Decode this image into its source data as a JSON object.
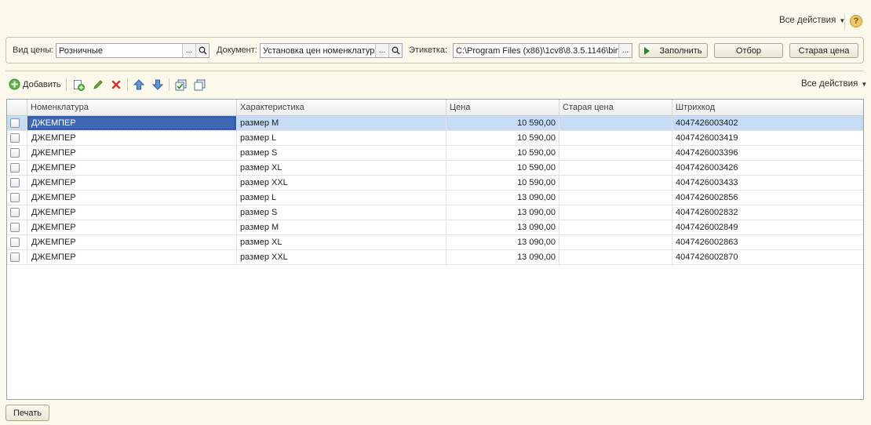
{
  "header": {
    "all_actions": "Все действия",
    "help": "?"
  },
  "filters": {
    "price_type_label": "Вид цены:",
    "price_type_value": "Розничные",
    "document_label": "Документ:",
    "document_value": "Установка цен номенклатур",
    "label_label": "Этикетка:",
    "label_value": "C:\\Program Files (x86)\\1cv8\\8.3.5.1146\\bin",
    "ellipsis": "...",
    "fill_button": "Заполнить",
    "filter_button": "Отбор",
    "old_price_button": "Старая цена"
  },
  "toolbar": {
    "add_label": "Добавить",
    "all_actions": "Все действия",
    "icons": [
      "add-icon",
      "copy-icon",
      "edit-icon",
      "delete-icon",
      "move-up-icon",
      "move-down-icon",
      "check-all-icon",
      "uncheck-all-icon"
    ]
  },
  "table": {
    "columns": [
      "Номенклатура",
      "Характеристика",
      "Цена",
      "Старая цена",
      "Штрихкод"
    ],
    "rows": [
      {
        "name": "ДЖЕМПЕР",
        "char": "размер M",
        "price": "10 590,00",
        "old": "",
        "barcode": "4047426003402"
      },
      {
        "name": "ДЖЕМПЕР",
        "char": "размер L",
        "price": "10 590,00",
        "old": "",
        "barcode": "4047426003419"
      },
      {
        "name": "ДЖЕМПЕР",
        "char": "размер S",
        "price": "10 590,00",
        "old": "",
        "barcode": "4047426003396"
      },
      {
        "name": "ДЖЕМПЕР",
        "char": "размер XL",
        "price": "10 590,00",
        "old": "",
        "barcode": "4047426003426"
      },
      {
        "name": "ДЖЕМПЕР",
        "char": "размер XXL",
        "price": "10 590,00",
        "old": "",
        "barcode": "4047426003433"
      },
      {
        "name": "ДЖЕМПЕР",
        "char": "размер L",
        "price": "13 090,00",
        "old": "",
        "barcode": "4047426002856"
      },
      {
        "name": "ДЖЕМПЕР",
        "char": "размер S",
        "price": "13 090,00",
        "old": "",
        "barcode": "4047426002832"
      },
      {
        "name": "ДЖЕМПЕР",
        "char": "размер M",
        "price": "13 090,00",
        "old": "",
        "barcode": "4047426002849"
      },
      {
        "name": "ДЖЕМПЕР",
        "char": "размер XL",
        "price": "13 090,00",
        "old": "",
        "barcode": "4047426002863"
      },
      {
        "name": "ДЖЕМПЕР",
        "char": "размер XXL",
        "price": "13 090,00",
        "old": "",
        "barcode": "4047426002870"
      }
    ]
  },
  "footer": {
    "print_button": "Печать"
  },
  "colors": {
    "background": "#fbf9ec",
    "selection": "#c5dcf4",
    "active_cell": "#3d67b4",
    "fill_icon": "#1f8a1f"
  }
}
